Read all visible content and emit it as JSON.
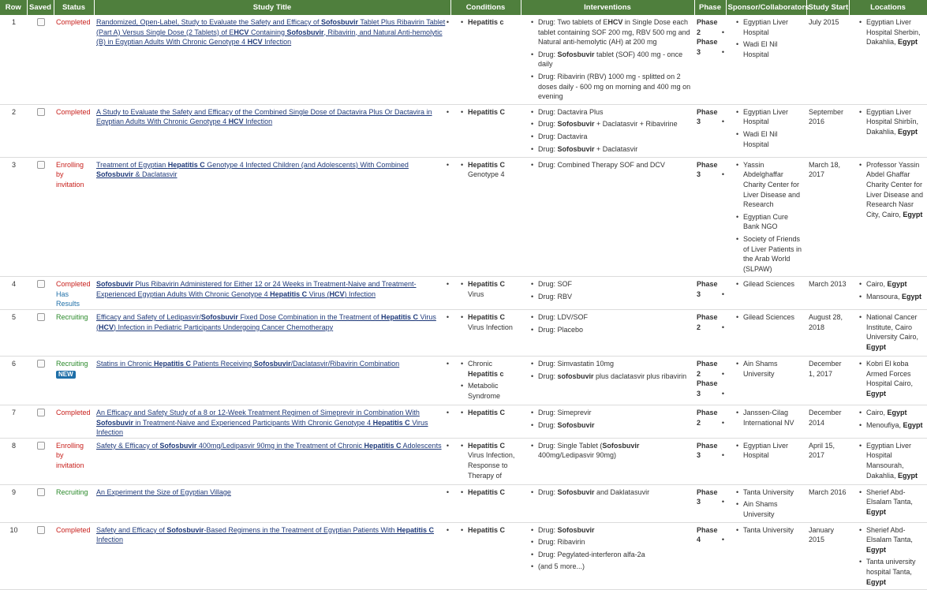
{
  "headers": {
    "row": "Row",
    "saved": "Saved",
    "status": "Status",
    "title": "Study Title",
    "conditions": "Conditions",
    "interventions": "Interventions",
    "phase": "Phase",
    "sponsor": "Sponsor/Collaborators",
    "start": "Study Start",
    "locations": "Locations"
  },
  "rows": [
    {
      "row": "1",
      "status": "Completed",
      "status_type": "completed",
      "title": "Randomized, Open-Label, Study to Evaluate the Safety and Efficacy of Sofosbuvir Tablet Plus Ribavirin Tablet (Part A) Versus Single Dose (2 Tablets) of EHCV Containing Sofosbuvir, Ribavirin, and Natural Anti-hemolytic (B) in Egyptian Adults With Chronic Genotype 4 HCV Infection",
      "conditions": [
        "Hepatitis c"
      ],
      "interventions": [
        "Drug: Two tablets of EHCV in Single Dose each tablet containing SOF 200 mg, RBV 500 mg and Natural anti-hemolytic (AH) at 200 mg",
        "Drug: Sofosbuvir tablet (SOF) 400 mg - once daily",
        "Drug: Ribavirin (RBV) 1000 mg - splitted on 2 doses daily - 600 mg on morning and 400 mg on evening"
      ],
      "phase": [
        "Phase 2",
        "Phase 3"
      ],
      "sponsor": [
        "Egyptian Liver Hospital",
        "Wadi El Nil Hospital"
      ],
      "start": "July 2015",
      "locations": [
        {
          "text": "Egyptian Liver Hospital Sherbin, Dakahlia,",
          "country": "Egypt"
        }
      ]
    },
    {
      "row": "2",
      "status": "Completed",
      "status_type": "completed",
      "title": "A Study to Evaluate the Safety and Efficacy of the Combined Single Dose of Dactavira Plus Or Dactavira in Egyptian Adults With Chronic Genotype 4 HCV Infection",
      "conditions": [
        "Hepatitis C"
      ],
      "interventions": [
        "Drug: Dactavira Plus",
        "Drug: Sofosbuvir + Daclatasvir + Ribavirine",
        "Drug: Dactavira",
        "Drug: Sofosbuvir + Daclatasvir"
      ],
      "phase": [
        "Phase 3"
      ],
      "sponsor": [
        "Egyptian Liver Hospital",
        "Wadi El Nil Hospital"
      ],
      "start": "September 2016",
      "locations": [
        {
          "text": "Egyptian Liver Hospital Shirbīn, Dakahlia,",
          "country": "Egypt"
        }
      ]
    },
    {
      "row": "3",
      "status": "Enrolling by invitation",
      "status_type": "enrolling",
      "title": "Treatment of Egyptian Hepatitis C Genotype 4 Infected Children (and Adolescents) With Combined Sofosbuvir & Daclatasvir",
      "conditions": [
        "Hepatitis C Genotype 4"
      ],
      "interventions": [
        "Drug: Combined Therapy SOF and DCV"
      ],
      "phase": [
        "Phase 3"
      ],
      "sponsor": [
        "Yassin Abdelghaffar Charity Center for Liver Disease and Research",
        "Egyptian Cure Bank NGO",
        "Society of Friends of Liver Patients in the Arab World (SLPAW)"
      ],
      "start": "March 18, 2017",
      "locations": [
        {
          "text": "Professor Yassin Abdel Ghaffar Charity Center for Liver Disease and Research Nasr City, Cairo,",
          "country": "Egypt"
        }
      ]
    },
    {
      "row": "4",
      "status": "Completed",
      "status_type": "completed",
      "results": "Has Results",
      "title": "Sofosbuvir Plus Ribavirin Administered for Either 12 or 24 Weeks in Treatment-Naive and Treatment-Experienced Egyptian Adults With Chronic Genotype 4 Hepatitis C Virus (HCV) Infection",
      "conditions": [
        "Hepatitis C Virus"
      ],
      "interventions": [
        "Drug: SOF",
        "Drug: RBV"
      ],
      "phase": [
        "Phase 3"
      ],
      "sponsor": [
        "Gilead Sciences"
      ],
      "start": "March 2013",
      "locations": [
        {
          "text": "Cairo,",
          "country": "Egypt"
        },
        {
          "text": "Mansoura,",
          "country": "Egypt"
        }
      ]
    },
    {
      "row": "5",
      "status": "Recruiting",
      "status_type": "recruiting",
      "title": "Efficacy and Safety of Ledipasvir/Sofosbuvir Fixed Dose Combination in the Treatment of Hepatitis C Virus (HCV) Infection in Pediatric Participants Undergoing Cancer Chemotherapy",
      "conditions": [
        "Hepatitis C Virus Infection"
      ],
      "interventions": [
        "Drug: LDV/SOF",
        "Drug: Placebo"
      ],
      "phase": [
        "Phase 2"
      ],
      "sponsor": [
        "Gilead Sciences"
      ],
      "start": "August 28, 2018",
      "locations": [
        {
          "text": "National Cancer Institute, Cairo University Cairo,",
          "country": "Egypt"
        }
      ]
    },
    {
      "row": "6",
      "status": "Recruiting",
      "status_type": "recruiting",
      "badge": "NEW",
      "title": "Statins in Chronic Hepatitis C Patients Receiving Sofosbuvir/Daclatasvir/Ribavirin Combination",
      "conditions": [
        "Chronic Hepatitis c",
        "Metabolic Syndrome"
      ],
      "interventions": [
        "Drug: Simvastatin 10mg",
        "Drug: sofosbuvir plus daclatasvir plus ribavirin"
      ],
      "phase": [
        "Phase 2",
        "Phase 3"
      ],
      "sponsor": [
        "Ain Shams University"
      ],
      "start": "December 1, 2017",
      "locations": [
        {
          "text": "Kobri El koba Armed Forces Hospital Cairo,",
          "country": "Egypt"
        }
      ]
    },
    {
      "row": "7",
      "status": "Completed",
      "status_type": "completed",
      "title": "An Efficacy and Safety Study of a 8 or 12-Week Treatment Regimen of Simeprevir in Combination With Sofosbuvir in Treatment-Naive and Experienced Participants With Chronic Genotype 4 Hepatitis C Virus Infection",
      "conditions": [
        "Hepatitis C"
      ],
      "interventions": [
        "Drug: Simeprevir",
        "Drug: Sofosbuvir"
      ],
      "phase": [
        "Phase 2"
      ],
      "sponsor": [
        "Janssen-Cilag International NV"
      ],
      "start": "December 2014",
      "locations": [
        {
          "text": "Cairo,",
          "country": "Egypt"
        },
        {
          "text": "Menoufiya,",
          "country": "Egypt"
        }
      ]
    },
    {
      "row": "8",
      "status": "Enrolling by invitation",
      "status_type": "enrolling",
      "title": "Safety & Efficacy of Sofosbuvir 400mg/Ledipasvir 90mg in the Treatment of Chronic Hepatitis C Adolescents",
      "conditions": [
        "Hepatitis C Virus Infection, Response to Therapy of"
      ],
      "interventions": [
        "Drug: Single Tablet (Sofosbuvir 400mg/Ledipasvir 90mg)"
      ],
      "phase": [
        "Phase 3"
      ],
      "sponsor": [
        "Egyptian Liver Hospital"
      ],
      "start": "April 15, 2017",
      "locations": [
        {
          "text": "Egyptian Liver Hospital Mansourah, Dakahlia,",
          "country": "Egypt"
        }
      ]
    },
    {
      "row": "9",
      "status": "Recruiting",
      "status_type": "recruiting",
      "title": "An Experiment the Size of Egyptian Village",
      "conditions": [
        "Hepatitis C"
      ],
      "interventions": [
        "Drug: Sofosbuvir and Daklatasuvir"
      ],
      "phase": [
        "Phase 3"
      ],
      "sponsor": [
        "Tanta University",
        "Ain Shams University"
      ],
      "start": "March 2016",
      "locations": [
        {
          "text": "Sherief Abd-Elsalam Tanta,",
          "country": "Egypt"
        }
      ]
    },
    {
      "row": "10",
      "status": "Completed",
      "status_type": "completed",
      "title": "Safety and Efficacy of Sofosbuvir-Based Regimens in the Treatment of Egyptian Patients With Hepatitis C Infection",
      "conditions": [
        "Hepatitis C"
      ],
      "interventions": [
        "Drug: Sofosbuvir",
        "Drug: Ribavirin",
        "Drug: Pegylated-interferon alfa-2a",
        "(and 5 more...)"
      ],
      "phase": [
        "Phase 4"
      ],
      "sponsor": [
        "Tanta University"
      ],
      "start": "January 2015",
      "locations": [
        {
          "text": "Sherief Abd-Elsalam Tanta,",
          "country": "Egypt"
        },
        {
          "text": "Tanta university hospital Tanta,",
          "country": "Egypt"
        }
      ]
    }
  ],
  "highlight_terms": [
    "Sofosbuvir",
    "sofosbuvir",
    "Hepatitis C",
    "Hepatitis c",
    "Hepatitis",
    "HCV"
  ],
  "colors": {
    "header_bg": "#4f7f3d",
    "completed": "#c8201c",
    "recruiting": "#2b8a2b",
    "link": "#1f3a7a",
    "badge": "#1f6fa8"
  }
}
